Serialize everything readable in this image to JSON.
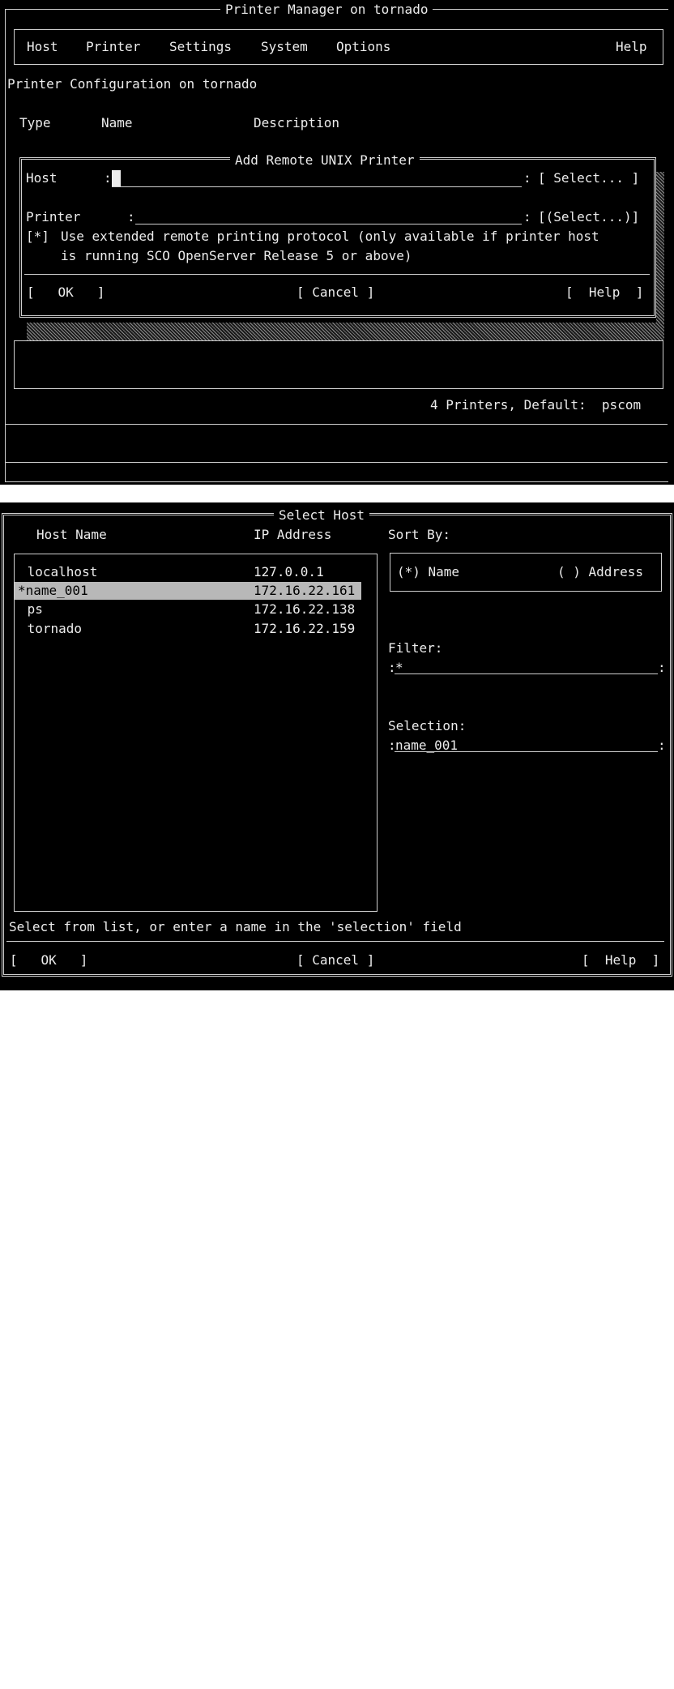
{
  "screen1": {
    "window_title": "Printer Manager on tornado",
    "menu": [
      "Host",
      "Printer",
      "Settings",
      "System",
      "Options"
    ],
    "menu_help": "Help",
    "config_title": "Printer Configuration on tornado",
    "columns": {
      "type": "Type",
      "name": "Name",
      "description": "Description"
    },
    "dialog": {
      "title": "Add Remote UNIX Printer",
      "host_label": "Host",
      "host_sep": ":",
      "host_end": ":",
      "host_value": "",
      "host_select": "[ Select... ]",
      "printer_label": "Printer",
      "printer_sep": ":",
      "printer_end": ":",
      "printer_value": "",
      "printer_select": "[(Select...)]",
      "checkbox": "[*]",
      "checkbox_line1": "Use extended remote printing protocol (only available if printer host",
      "checkbox_line2": "is running SCO OpenServer Release 5 or above)",
      "ok": "[   OK   ]",
      "cancel": "[ Cancel ]",
      "help": "[  Help  ]"
    },
    "status": "4 Printers, Default:  pscom"
  },
  "screen2": {
    "title": "Select Host",
    "col_host": "Host Name",
    "col_ip": "IP Address",
    "sort_by": "Sort By:",
    "sort_name": "(*) Name",
    "sort_address": "( ) Address",
    "hosts": [
      {
        "name": " localhost",
        "ip": "127.0.0.1"
      },
      {
        "name": "*name_001",
        "ip": "172.16.22.161"
      },
      {
        "name": " ps",
        "ip": "172.16.22.138"
      },
      {
        "name": " tornado",
        "ip": "172.16.22.159"
      }
    ],
    "filter_label": "Filter:",
    "filter_value": "*",
    "selection_label": "Selection:",
    "selection_value": "name_001",
    "hint": "Select from list, or enter a name in the 'selection' field",
    "ok": "[   OK   ]",
    "cancel": "[ Cancel ]",
    "help": "[  Help  ]"
  }
}
